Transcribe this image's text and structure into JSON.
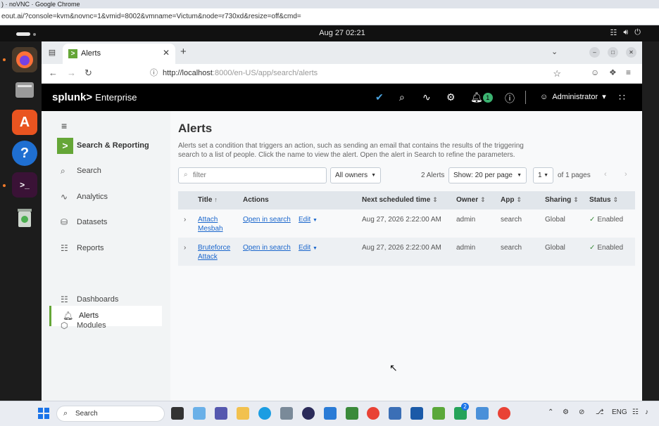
{
  "host": {
    "window_title": ") · noVNC · Google Chrome",
    "url": "eout.ai/?console=kvm&novnc=1&vmid=8002&vmname=Victum&node=r730xd&resize=off&cmd="
  },
  "gnome": {
    "clock": "Aug 27  02:21"
  },
  "browser": {
    "tab_title": "Alerts",
    "address_host": "http://localhost",
    "address_path": ":8000/en-US/app/search/alerts"
  },
  "splunk": {
    "logo": "splunk>",
    "product": "Enterprise",
    "user": "Administrator",
    "notification_count": "1",
    "sidebar": {
      "app_label": "Search & Reporting",
      "items": [
        {
          "label": "Search",
          "icon": "search-icon"
        },
        {
          "label": "Analytics",
          "icon": "analytics-icon"
        },
        {
          "label": "Datasets",
          "icon": "datasets-icon"
        },
        {
          "label": "Reports",
          "icon": "reports-icon"
        },
        {
          "label": "Alerts",
          "icon": "bell-icon",
          "active": true
        },
        {
          "label": "Dashboards",
          "icon": "dashboards-icon"
        },
        {
          "label": "Modules",
          "icon": "modules-icon"
        }
      ]
    },
    "page": {
      "title": "Alerts",
      "description": "Alerts set a condition that triggers an action, such as sending an email that contains the results of the triggering search to a list of people. Click the name to view the alert. Open the alert in Search to refine the parameters.",
      "filter_placeholder": "filter",
      "owners_label": "All owners",
      "count_label": "2 Alerts",
      "per_page_label": "Show: 20 per page",
      "page_select": "1",
      "page_of": "of 1 pages"
    },
    "table": {
      "headers": {
        "title": "Title",
        "actions": "Actions",
        "next": "Next scheduled time",
        "owner": "Owner",
        "app": "App",
        "sharing": "Sharing",
        "status": "Status"
      },
      "rows": [
        {
          "title_line1": "Attach",
          "title_line2": "Mesbah",
          "action_open": "Open in search",
          "action_edit": "Edit",
          "next": "Aug 27, 2026 2:22:00 AM",
          "owner": "admin",
          "app": "search",
          "sharing": "Global",
          "status": "Enabled"
        },
        {
          "title_line1": "Bruteforce",
          "title_line2": "Attack",
          "action_open": "Open in search",
          "action_edit": "Edit",
          "next": "Aug 27, 2026 2:22:00 AM",
          "owner": "admin",
          "app": "search",
          "sharing": "Global",
          "status": "Enabled"
        }
      ]
    }
  },
  "taskbar": {
    "search_label": "Search",
    "lang": "ENG",
    "teams_badge": "2"
  }
}
